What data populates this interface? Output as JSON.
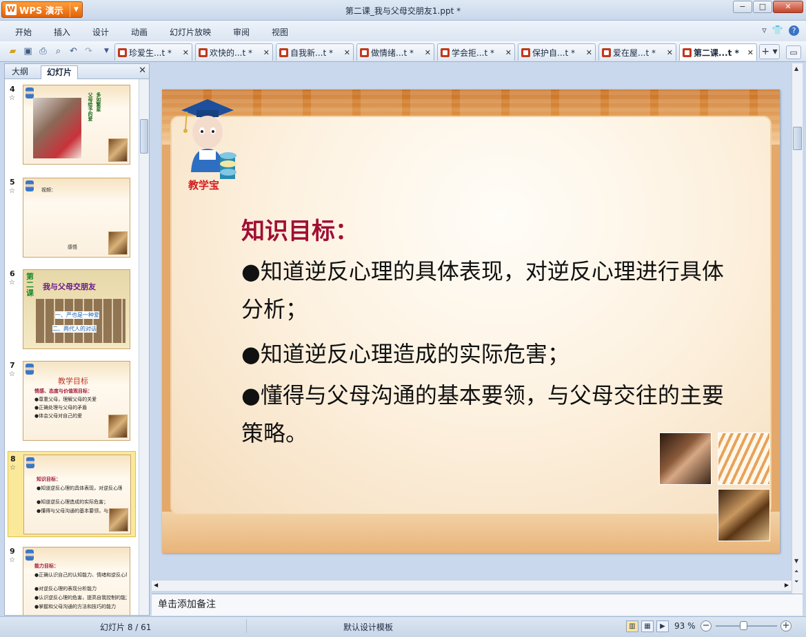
{
  "app": {
    "name": "WPS 演示",
    "window_title": "第二课_我与父母交朋友1.ppt *"
  },
  "window_controls": {
    "minimize": "−",
    "maximize": "□",
    "close": "✕"
  },
  "menu": {
    "items": [
      "开始",
      "插入",
      "设计",
      "动画",
      "幻灯片放映",
      "审阅",
      "视图"
    ],
    "right_icons": [
      "chevron-down-icon",
      "shirt-icon",
      "help-icon"
    ]
  },
  "toolbar": {
    "icons": [
      "open-folder-icon",
      "save-icon",
      "print-icon",
      "print-preview-icon",
      "undo-icon",
      "redo-icon",
      "dropdown-icon"
    ]
  },
  "doc_tabs": [
    {
      "label": "珍爱生...t *",
      "active": false
    },
    {
      "label": "欢快的...t *",
      "active": false
    },
    {
      "label": "自我新...t *",
      "active": false
    },
    {
      "label": "做情绪...t *",
      "active": false
    },
    {
      "label": "学会拒...t *",
      "active": false
    },
    {
      "label": "保护自...t *",
      "active": false
    },
    {
      "label": "爱在屋...t *",
      "active": false
    },
    {
      "label": "第二课...t *",
      "active": true
    }
  ],
  "panel": {
    "tabs": [
      "大纲",
      "幻灯片"
    ],
    "active_tab": "幻灯片",
    "thumbnails": [
      {
        "num": "4",
        "lines": [
          "父母给予的爱",
          "多如繁星"
        ]
      },
      {
        "num": "5",
        "lines": [
          "视频：",
          "感悟"
        ]
      },
      {
        "num": "6",
        "lines": [
          "第二课",
          "我与父母交朋友",
          "一、严也是一种爱",
          "二、两代人的对话"
        ]
      },
      {
        "num": "7",
        "lines": [
          "教学目标",
          "情感、态度与价值观目标：",
          "●尊重父母，理解父母的关爱",
          "●正确处理与父母的矛盾",
          "●体会父母对自己的爱"
        ]
      },
      {
        "num": "8",
        "lines": [
          "知识目标：",
          "●知道逆反心理的具体表现，对逆反心理进行具体分析；",
          "●知道逆反心理造成的实际危害；",
          "●懂得与父母沟通的基本要领，与父母交往的主要策略。"
        ]
      },
      {
        "num": "9",
        "lines": [
          "能力目标：",
          "●正确认识自己的认知能力、情绪和逆反心理的能力",
          "●对逆反心理的表现分析能力",
          "●认识逆反心理的危害，提高自我控制的能力",
          "●掌握和父母沟通的方法和技巧的能力"
        ]
      }
    ]
  },
  "slide": {
    "mascot_label": "教学宝",
    "heading": "知识目标：",
    "bullets": [
      "●知道逆反心理的具体表现，对逆反心理进行具体分析；",
      "●知道逆反心理造成的实际危害；",
      "●懂得与父母沟通的基本要领，与父母交往的主要策略。"
    ]
  },
  "notes": {
    "placeholder": "单击添加备注"
  },
  "status": {
    "slide_indicator": "幻灯片 8 / 61",
    "template": "默认设计模板",
    "zoom": "93 %",
    "zoom_level": 0.46
  },
  "colors": {
    "heading": "#a00f34",
    "accent": "#e2620b",
    "mascot_label": "#d11d1d"
  }
}
